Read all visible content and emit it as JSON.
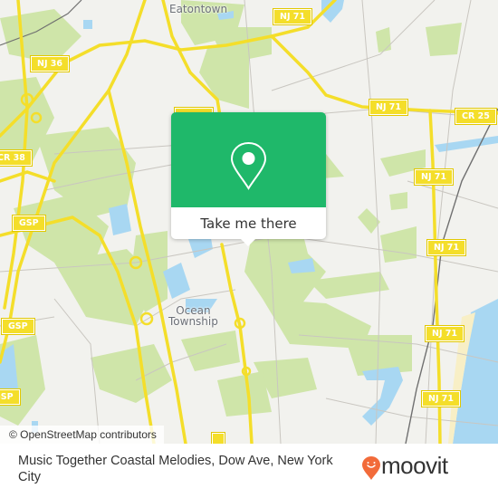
{
  "map": {
    "place_labels": [
      {
        "name": "Eatontown"
      },
      {
        "name": "Ocean Township",
        "lines": [
          "Ocean",
          "Township"
        ]
      }
    ],
    "road_shields": [
      "NJ 36",
      "NJ 71",
      "NJ 71",
      "CR 25",
      "NJ 71",
      "NJ 71",
      "NJ 71",
      "NJ 71",
      "CR 38",
      "GSP",
      "GSP",
      "GSP"
    ],
    "colors": {
      "land": "#f2f2ee",
      "park": "#cfe5a9",
      "water": "#a8d7f2",
      "highway": "#f4de2a",
      "road": "#c9c6c0"
    },
    "attribution": "© OpenStreetMap contributors"
  },
  "popup": {
    "icon": "map-pin-icon",
    "action_label": "Take me there",
    "accent_color": "#1fb86a"
  },
  "footer": {
    "title": "Music Together Coastal Melodies, Dow Ave, New York City",
    "brand": "moovit",
    "brand_color": "#f26b3a"
  }
}
